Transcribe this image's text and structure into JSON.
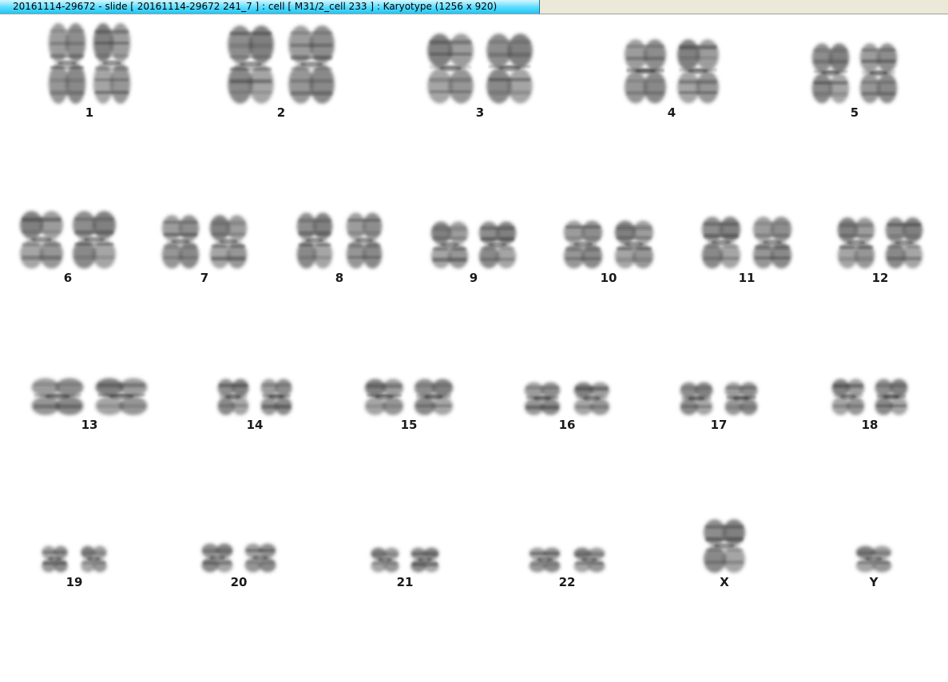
{
  "window": {
    "title": "20161114-29672 - slide [ 20161114-29672 241_7 ] : cell [ M31/2_cell 233 ] : Karyotype  (1256 x 920)"
  },
  "karyotype": {
    "chromosomes": [
      {
        "id": "1",
        "label": "1"
      },
      {
        "id": "2",
        "label": "2"
      },
      {
        "id": "3",
        "label": "3"
      },
      {
        "id": "4",
        "label": "4"
      },
      {
        "id": "5",
        "label": "5"
      },
      {
        "id": "6",
        "label": "6"
      },
      {
        "id": "7",
        "label": "7"
      },
      {
        "id": "8",
        "label": "8"
      },
      {
        "id": "9",
        "label": "9"
      },
      {
        "id": "10",
        "label": "10"
      },
      {
        "id": "11",
        "label": "11"
      },
      {
        "id": "12",
        "label": "12"
      },
      {
        "id": "13",
        "label": "13"
      },
      {
        "id": "14",
        "label": "14"
      },
      {
        "id": "15",
        "label": "15"
      },
      {
        "id": "16",
        "label": "16"
      },
      {
        "id": "17",
        "label": "17"
      },
      {
        "id": "18",
        "label": "18"
      },
      {
        "id": "19",
        "label": "19"
      },
      {
        "id": "20",
        "label": "20"
      },
      {
        "id": "21",
        "label": "21"
      },
      {
        "id": "22",
        "label": "22"
      },
      {
        "id": "X",
        "label": "X"
      },
      {
        "id": "Y",
        "label": "Y"
      }
    ],
    "stain_color": "#4a4a4a"
  }
}
